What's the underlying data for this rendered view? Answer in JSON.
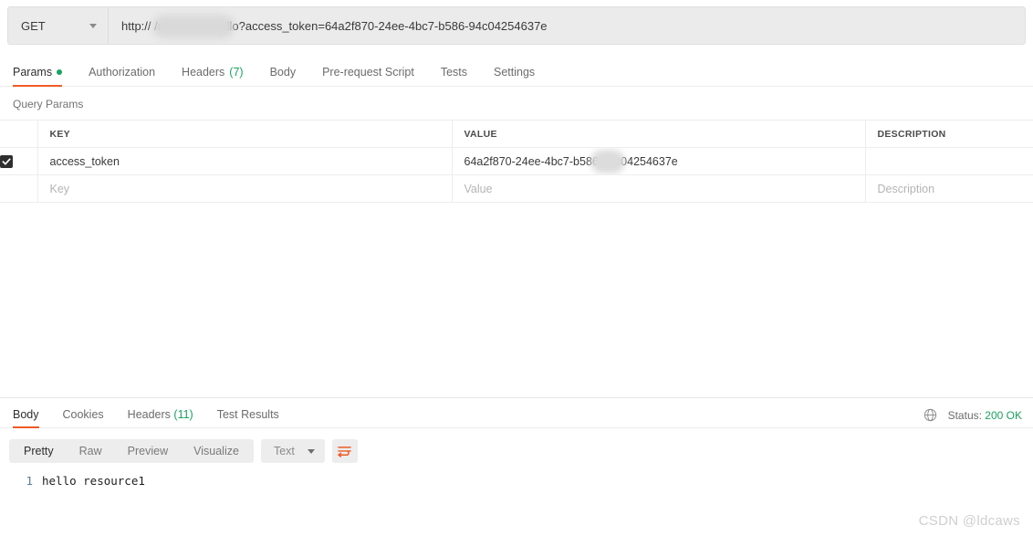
{
  "request": {
    "method": "GET",
    "method_icon": "chevron-down-icon",
    "url": "http://                    /resource1/hello?access_token=64a2f870-24ee-4bc7-b586-94c04254637e",
    "url_prefix": "http:/",
    "url_suffix": "/resource1/hello?access_token=64a2f870-24ee-4bc7-b586-94c04254637e",
    "tabs": [
      {
        "label": "Params",
        "active": true,
        "dot": true
      },
      {
        "label": "Authorization",
        "active": false
      },
      {
        "label": "Headers",
        "active": false,
        "count": "(7)"
      },
      {
        "label": "Body",
        "active": false
      },
      {
        "label": "Pre-request Script",
        "active": false
      },
      {
        "label": "Tests",
        "active": false
      },
      {
        "label": "Settings",
        "active": false
      }
    ]
  },
  "query_params": {
    "section_label": "Query Params",
    "headers": [
      "KEY",
      "VALUE",
      "DESCRIPTION"
    ],
    "rows": [
      {
        "checked": true,
        "key": "access_token",
        "value": "64a2f870-24ee-4bc7-b586-94c04254637e",
        "description": ""
      }
    ],
    "placeholder_row": {
      "key": "Key",
      "value": "Value",
      "description": "Description"
    }
  },
  "response": {
    "tabs": [
      {
        "label": "Body",
        "active": true
      },
      {
        "label": "Cookies",
        "active": false
      },
      {
        "label": "Headers",
        "active": false,
        "count": "(11)"
      },
      {
        "label": "Test Results",
        "active": false
      }
    ],
    "status_label": "Status:",
    "status_value": "200 OK",
    "globe_icon": "globe-icon",
    "view_modes": [
      {
        "label": "Pretty",
        "active": true
      },
      {
        "label": "Raw",
        "active": false
      },
      {
        "label": "Preview",
        "active": false
      },
      {
        "label": "Visualize",
        "active": false
      }
    ],
    "format_select": "Text",
    "wrap_icon": "word-wrap-icon",
    "body_lines": [
      {
        "number": "1",
        "text": "hello resource1"
      }
    ]
  },
  "colors": {
    "accent": "#ef5b25",
    "success": "#1aa260",
    "muted": "#6b6b6b"
  },
  "watermark": "CSDN @ldcaws"
}
